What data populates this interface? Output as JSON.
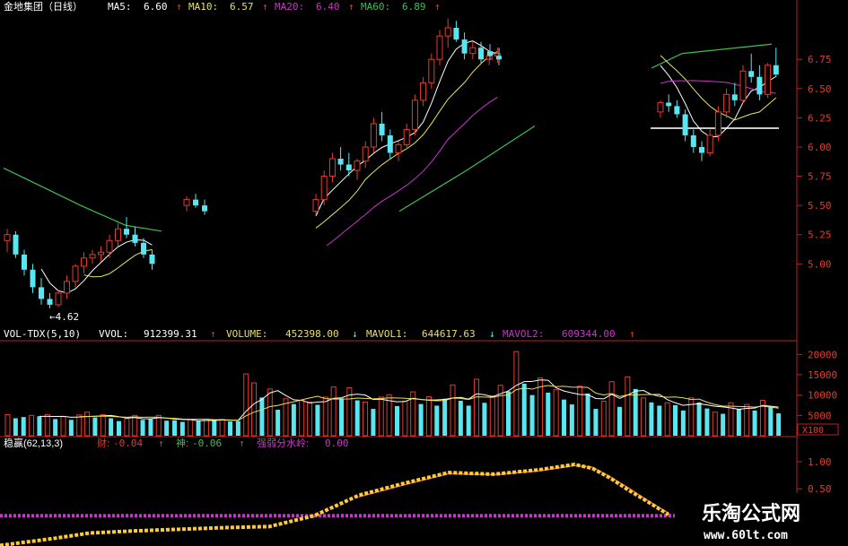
{
  "header": {
    "title": "金地集团（日线）",
    "ma5_label": "MA5:",
    "ma5_value": "6.60",
    "ma10_label": "MA10:",
    "ma10_value": "6.57",
    "ma20_label": "MA20:",
    "ma20_value": "6.40",
    "ma60_label": "MA60:",
    "ma60_value": "6.89",
    "arrow": "↑"
  },
  "vol_header": {
    "name": "VOL-TDX(5,10)",
    "vvol_label": "VVOL:",
    "vvol_value": "912399.31",
    "vvol_arrow": "↑",
    "volume_label": "VOLUME:",
    "volume_value": "452398.00",
    "volume_arrow": "↓",
    "mavol1_label": "MAVOL1:",
    "mavol1_value": "644617.63",
    "mavol1_arrow": "↓",
    "mavol2_label": "MAVOL2:",
    "mavol2_value": "609344.00",
    "mavol2_arrow": "↑"
  },
  "ind_header": {
    "name": "稳赢(62,13,3)",
    "t1_label": "财:",
    "t1_value": "-0.04",
    "t1_arrow": "↑",
    "t2_label": "神:",
    "t2_value": "-0.06",
    "t2_arrow": "↑",
    "t3_label": "强弱分水岭:",
    "t3_value": "0.00"
  },
  "low_marker": "4.62",
  "vol_unit": "X100",
  "watermark": {
    "line1": "乐淘公式网",
    "line2": "www.60lt.com"
  },
  "colors": {
    "background": "#000000",
    "up": "#e83a2b",
    "down": "#58e6f0",
    "ma5": "#ffffff",
    "ma10": "#e8e060",
    "ma20": "#cc33cc",
    "ma60": "#3fbf4f",
    "axis": "#c02020",
    "ind1": "#ffcc33",
    "ind2": "#e06030",
    "divider": "#cc33cc"
  },
  "chart_data": [
    {
      "type": "candlestick",
      "title": "金地集团（日线）",
      "y_ticks": [
        5.0,
        5.25,
        5.5,
        5.75,
        6.0,
        6.25,
        6.5,
        6.75
      ],
      "ylim": [
        4.45,
        7.12
      ],
      "low_annotation": 4.62,
      "candles": [
        [
          5.2,
          5.3,
          5.1,
          5.25
        ],
        [
          5.25,
          5.28,
          5.05,
          5.08
        ],
        [
          5.08,
          5.12,
          4.9,
          4.95
        ],
        [
          4.95,
          5.0,
          4.75,
          4.8
        ],
        [
          4.8,
          4.88,
          4.65,
          4.7
        ],
        [
          4.7,
          4.75,
          4.62,
          4.65
        ],
        [
          4.65,
          4.78,
          4.63,
          4.75
        ],
        [
          4.75,
          4.9,
          4.7,
          4.85
        ],
        [
          4.85,
          5.0,
          4.8,
          4.98
        ],
        [
          4.98,
          5.1,
          4.92,
          5.05
        ],
        [
          5.05,
          5.12,
          5.0,
          5.08
        ],
        [
          5.08,
          5.15,
          5.02,
          5.1
        ],
        [
          5.1,
          5.25,
          5.05,
          5.2
        ],
        [
          5.2,
          5.35,
          5.15,
          5.3
        ],
        [
          5.3,
          5.4,
          5.22,
          5.25
        ],
        [
          5.25,
          5.32,
          5.15,
          5.18
        ],
        [
          5.18,
          5.22,
          5.05,
          5.08
        ],
        [
          5.08,
          5.12,
          4.95,
          5.0
        ],
        [
          5.5,
          5.58,
          5.45,
          5.55
        ],
        [
          5.55,
          5.6,
          5.48,
          5.5
        ],
        [
          5.5,
          5.55,
          5.42,
          5.45
        ],
        [
          5.45,
          5.6,
          5.42,
          5.55
        ],
        [
          5.55,
          5.8,
          5.5,
          5.75
        ],
        [
          5.75,
          5.95,
          5.7,
          5.9
        ],
        [
          5.9,
          6.0,
          5.8,
          5.85
        ],
        [
          5.85,
          5.95,
          5.75,
          5.8
        ],
        [
          5.8,
          5.9,
          5.72,
          5.88
        ],
        [
          5.88,
          6.05,
          5.82,
          6.0
        ],
        [
          6.0,
          6.25,
          5.95,
          6.2
        ],
        [
          6.2,
          6.3,
          6.05,
          6.1
        ],
        [
          6.1,
          6.15,
          5.9,
          5.95
        ],
        [
          5.95,
          6.05,
          5.88,
          6.02
        ],
        [
          6.02,
          6.2,
          5.98,
          6.15
        ],
        [
          6.15,
          6.45,
          6.1,
          6.4
        ],
        [
          6.4,
          6.6,
          6.35,
          6.55
        ],
        [
          6.55,
          6.8,
          6.5,
          6.75
        ],
        [
          6.75,
          7.0,
          6.7,
          6.95
        ],
        [
          6.95,
          7.1,
          6.85,
          7.02
        ],
        [
          7.02,
          7.08,
          6.9,
          6.92
        ],
        [
          6.92,
          6.98,
          6.75,
          6.8
        ],
        [
          6.8,
          6.9,
          6.75,
          6.85
        ],
        [
          6.85,
          6.9,
          6.72,
          6.75
        ],
        [
          6.75,
          6.82,
          6.7,
          6.78
        ],
        [
          6.78,
          6.85,
          6.72,
          6.8
        ],
        [
          6.82,
          6.88,
          6.75,
          6.78
        ],
        [
          6.78,
          6.85,
          6.7,
          6.75
        ],
        [
          6.3,
          6.4,
          6.25,
          6.38
        ],
        [
          6.38,
          6.45,
          6.3,
          6.35
        ],
        [
          6.35,
          6.4,
          6.25,
          6.28
        ],
        [
          6.28,
          6.32,
          6.05,
          6.1
        ],
        [
          6.1,
          6.15,
          5.95,
          6.0
        ],
        [
          6.0,
          6.05,
          5.88,
          5.95
        ],
        [
          5.95,
          6.15,
          5.92,
          6.1
        ],
        [
          6.1,
          6.35,
          6.05,
          6.3
        ],
        [
          6.3,
          6.5,
          6.25,
          6.45
        ],
        [
          6.45,
          6.55,
          6.35,
          6.4
        ],
        [
          6.4,
          6.7,
          6.38,
          6.65
        ],
        [
          6.65,
          6.8,
          6.55,
          6.6
        ],
        [
          6.6,
          6.7,
          6.4,
          6.45
        ],
        [
          6.45,
          6.72,
          6.42,
          6.7
        ],
        [
          6.7,
          6.85,
          6.6,
          6.62
        ]
      ],
      "ma60": [
        [
          0,
          5.75
        ],
        [
          18,
          5.33
        ],
        [
          35,
          5.55
        ],
        [
          45,
          6.2
        ],
        [
          55,
          6.65
        ],
        [
          63,
          6.78
        ]
      ]
    },
    {
      "type": "bar",
      "title": "VOL-TDX(5,10)",
      "y_ticks": [
        5000,
        10000,
        15000,
        20000
      ],
      "unit": "X100",
      "ylim": [
        0,
        22500
      ],
      "values": [
        5200,
        4300,
        4600,
        5000,
        4800,
        5200,
        4100,
        4700,
        3900,
        5100,
        5800,
        4500,
        5200,
        4300,
        3600,
        4200,
        5000,
        3900,
        4100,
        5000,
        3700,
        3800,
        3400,
        3900,
        3600,
        4100,
        3800,
        4000,
        3500,
        3600,
        15200,
        13000,
        9400,
        11500,
        6400,
        9100,
        7800,
        8700,
        8300,
        7600,
        9500,
        12000,
        9200,
        11800,
        8700,
        8300,
        6600,
        9500,
        10100,
        7300,
        8500,
        10800,
        7800,
        9600,
        7400,
        9100,
        12500,
        8600,
        7400,
        13900,
        8100,
        9800,
        12400,
        10900,
        20700,
        12800,
        10000,
        14200,
        10600,
        11300,
        8900,
        7700,
        12200,
        10400,
        6600,
        8500,
        13300,
        7100,
        14500,
        11500,
        9300,
        8200,
        7400,
        8100,
        7500,
        6200,
        9300,
        8200,
        6700,
        5800,
        5400,
        8100,
        6600,
        7700,
        6200,
        8700,
        7000,
        5500
      ],
      "up": [
        true,
        false,
        false,
        true,
        false,
        true,
        false,
        true,
        false,
        true,
        true,
        false,
        true,
        false,
        false,
        true,
        true,
        false,
        false,
        true,
        false,
        false,
        false,
        true,
        false,
        true,
        false,
        true,
        false,
        false,
        true,
        true,
        false,
        true,
        false,
        true,
        false,
        true,
        true,
        false,
        true,
        true,
        false,
        true,
        false,
        true,
        false,
        true,
        true,
        false,
        true,
        true,
        false,
        true,
        false,
        false,
        true,
        false,
        false,
        true,
        false,
        true,
        true,
        false,
        true,
        false,
        false,
        true,
        false,
        true,
        false,
        false,
        true,
        false,
        false,
        true,
        true,
        false,
        true,
        false,
        true,
        false,
        false,
        true,
        false,
        false,
        true,
        false,
        false,
        true,
        false,
        true,
        false,
        true,
        false,
        true,
        false,
        false
      ]
    },
    {
      "type": "line",
      "title": "稳赢(62,13,3)",
      "y_ticks": [
        0.0,
        0.5,
        1.0
      ],
      "ylim": [
        -0.56,
        1.25
      ],
      "divider": 0.0,
      "series": [
        {
          "name": "财",
          "x": [
            0,
            60,
            100,
            150,
            200,
            250,
            300,
            350,
            400,
            450,
            500,
            550,
            600,
            640,
            660,
            680,
            700,
            720,
            745
          ],
          "values": [
            -0.55,
            -0.42,
            -0.32,
            -0.28,
            -0.25,
            -0.22,
            -0.2,
            0.0,
            0.38,
            0.6,
            0.8,
            0.77,
            0.85,
            0.95,
            0.88,
            0.7,
            0.48,
            0.28,
            0.02
          ]
        },
        {
          "name": "神",
          "x": [
            400,
            450,
            500,
            550,
            600,
            640,
            660,
            680,
            700,
            720,
            745
          ],
          "values": [
            0.35,
            0.57,
            0.78,
            0.76,
            0.83,
            0.93,
            0.9,
            0.72,
            0.52,
            0.3,
            0.05
          ]
        }
      ]
    }
  ]
}
